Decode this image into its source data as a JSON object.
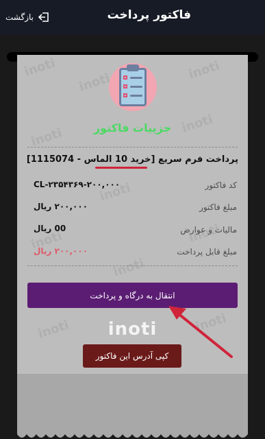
{
  "header": {
    "title": "فاکتور پرداخت",
    "back_label": "بازگشت"
  },
  "invoice": {
    "heading": "جزییات فاکتور",
    "description": "پرداخت فرم سریع [خرید 10 الماس - 1115074]",
    "rows": [
      {
        "label": "کد فاکتور",
        "value": "CL-۲۳۵۴۳۶۹-۲۰۰,۰۰۰"
      },
      {
        "label": "مبلغ فاکتور",
        "value": "۲۰۰,۰۰۰ ریال"
      },
      {
        "label": "مالیات و عوارض",
        "value": "00 ریال"
      },
      {
        "label": "مبلغ قابل پرداخت",
        "value": "۲۰۰,۰۰۰ ریال"
      }
    ],
    "pay_button": "انتقال به درگاه و پرداخت",
    "logo_text": "inoti",
    "copy_button": "کپی آدرس این فاکتور",
    "watermark": "inoti"
  },
  "colors": {
    "accent_purple": "#5b1d73",
    "copy_button": "#6b1a1a",
    "heading_green": "#4cd964",
    "payable_pink": "#e05a6a",
    "annotation_red": "#d0243a"
  },
  "icons": {
    "back": "exit-arrow-icon",
    "avatar": "clipboard-checklist-icon"
  }
}
